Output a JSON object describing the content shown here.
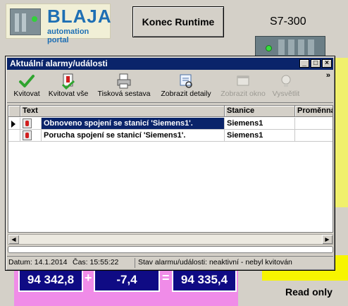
{
  "background": {
    "logo_title": "BLAJA",
    "logo_subtitle": "automation portal",
    "runtime_button": "Konec Runtime",
    "plc_label": "S7-300",
    "calc_value1": "94 342,8",
    "calc_op1": "+",
    "calc_value2": "-7,4",
    "calc_op2": "=",
    "calc_result": "94 335,4",
    "readonly_label": "Read only"
  },
  "window": {
    "title": "Aktuální alarmy/události",
    "controls": [
      "minimize",
      "maximize",
      "close"
    ],
    "toolbar": [
      {
        "label": "Kvitovat",
        "icon": "checkmark-icon",
        "enabled": true
      },
      {
        "label": "Kvitovat vše",
        "icon": "acknowledge-all-icon",
        "enabled": true
      },
      {
        "label": "Tisková sestava",
        "icon": "print-report-icon",
        "enabled": true
      },
      {
        "label": "Zobrazit detaily",
        "icon": "details-icon",
        "enabled": true
      },
      {
        "label": "Zobrazit okno",
        "icon": "window-icon",
        "enabled": false
      },
      {
        "label": "Vysvětlit",
        "icon": "lightbulb-icon",
        "enabled": false
      }
    ],
    "overflow": "»",
    "columns": [
      "Text",
      "Stanice",
      "Proměnná"
    ],
    "rows": [
      {
        "text": "Obnoveno spojení se stanicí 'Siemens1'.",
        "station": "Siemens1",
        "variable": "",
        "selected": true
      },
      {
        "text": "Porucha spojení se stanicí 'Siemens1'.",
        "station": "Siemens1",
        "variable": "",
        "selected": false
      }
    ],
    "status": {
      "date": "Datum: 14.1.2014",
      "time": "Čas: 15:55:22",
      "state": "Stav alarmu/události: neaktivní - nebyl kvitován"
    }
  },
  "colors": {
    "titlebar": "#0a246a",
    "selection": "#0a246a",
    "calc_box": "#0f0b84",
    "pink": "#f08ce8",
    "yellow": "#f7f500"
  }
}
